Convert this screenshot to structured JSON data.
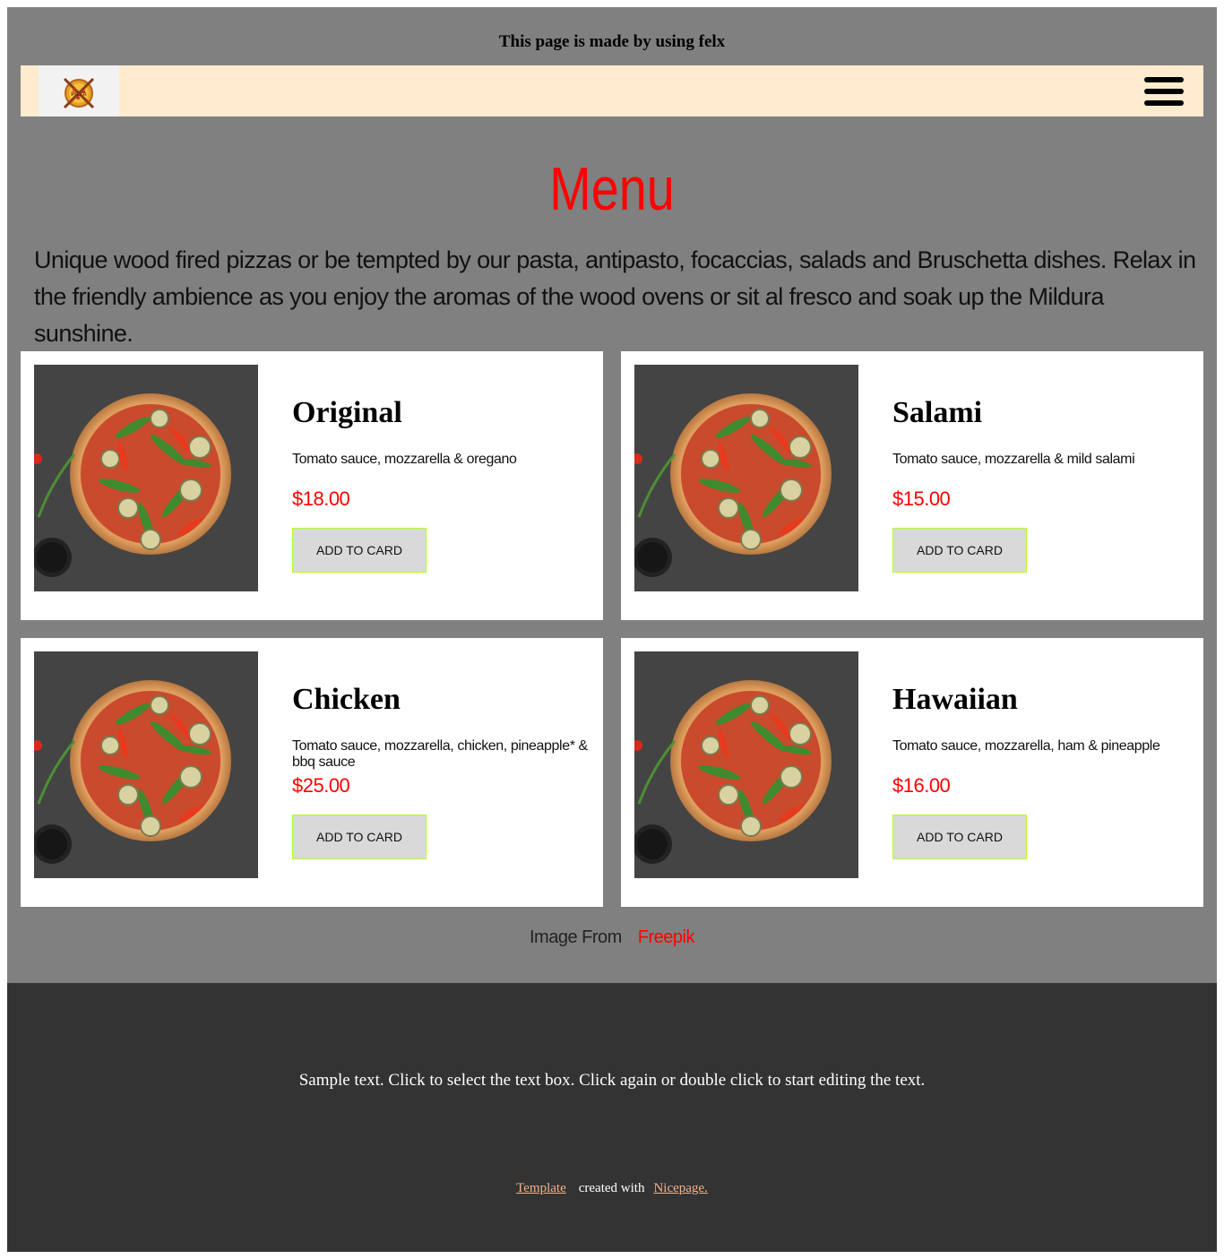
{
  "header": {
    "note": "This page is made by using felx",
    "logo_icon": "pizza-logo-icon",
    "menu_icon": "hamburger-menu-icon"
  },
  "menu": {
    "title": "Menu",
    "intro": "Unique wood fired pizzas or be tempted by our pasta, antipasto, focaccias, salads and Bruschetta dishes. Relax in the friendly ambience as you enjoy the aromas of the wood ovens or sit al fresco and soak up the Mildura sunshine.",
    "items": [
      {
        "name": "Original",
        "description": "Tomato sauce, mozzarella & oregano",
        "price": "$18.00",
        "button": "ADD TO CARD"
      },
      {
        "name": "Salami",
        "description": "Tomato sauce, mozzarella & mild salami",
        "price": "$15.00",
        "button": "ADD TO CARD"
      },
      {
        "name": "Chicken",
        "description": "Tomato sauce, mozzarella, chicken, pineapple* & bbq sauce",
        "price": "$25.00",
        "button": "ADD TO CARD"
      },
      {
        "name": "Hawaiian",
        "description": "Tomato sauce, mozzarella, ham & pineapple",
        "price": "$16.00",
        "button": "ADD TO CARD"
      }
    ]
  },
  "credit": {
    "label": "Image From",
    "link": "Freepik"
  },
  "footer": {
    "text": "Sample text. Click to select the text box. Click again or double click to start editing the text.",
    "template_link": "Template",
    "middle": "created with",
    "nicepage_link": "Nicepage."
  },
  "colors": {
    "accent": "#ff0000",
    "navbar": "#ffebcd",
    "page_bg": "#808080",
    "footer_bg": "#333333",
    "link": "#f0b48a",
    "button_border": "#adff2f"
  }
}
